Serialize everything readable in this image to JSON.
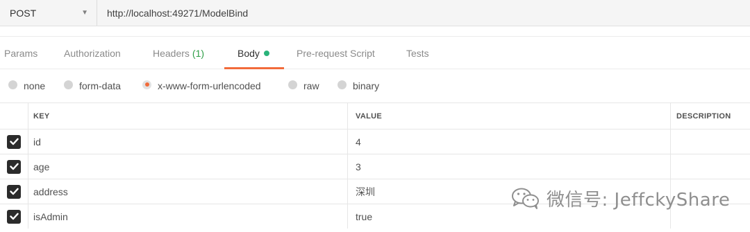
{
  "request": {
    "method": "POST",
    "url": "http://localhost:49271/ModelBind"
  },
  "tabs": [
    {
      "label": "Params"
    },
    {
      "label": "Authorization"
    },
    {
      "label": "Headers",
      "count": "(1)"
    },
    {
      "label": "Body",
      "active": true
    },
    {
      "label": "Pre-request Script"
    },
    {
      "label": "Tests"
    }
  ],
  "body_types": [
    {
      "label": "none"
    },
    {
      "label": "form-data"
    },
    {
      "label": "x-www-form-urlencoded",
      "selected": true
    },
    {
      "label": "raw"
    },
    {
      "label": "binary"
    }
  ],
  "table": {
    "headers": {
      "key": "KEY",
      "value": "VALUE",
      "description": "DESCRIPTION"
    },
    "rows": [
      {
        "checked": true,
        "key": "id",
        "value": "4",
        "description": ""
      },
      {
        "checked": true,
        "key": "age",
        "value": "3",
        "description": ""
      },
      {
        "checked": true,
        "key": "address",
        "value": "深圳",
        "description": ""
      },
      {
        "checked": true,
        "key": "isAdmin",
        "value": "true",
        "description": ""
      }
    ]
  },
  "watermark": {
    "text": "微信号: JeffckyShare"
  },
  "colors": {
    "accent": "#f26b3a",
    "body_dot": "#2ab37a",
    "headers_count": "#2e9e47"
  },
  "icons": {
    "method_dropdown": "caret-down-icon",
    "checkbox": "check-icon",
    "watermark_logo": "wechat-icon"
  }
}
